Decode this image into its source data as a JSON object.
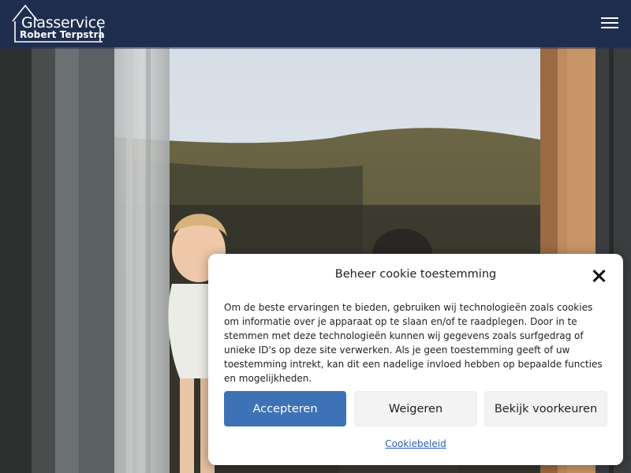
{
  "header": {
    "logo_line1": "Glasservice",
    "logo_line2": "Robert Terpstra",
    "background": "#1f2e4e",
    "menu_icon": "hamburger-menu-icon"
  },
  "hero": {
    "scene": "family-behind-window-photo"
  },
  "cookie_dialog": {
    "title": "Beheer cookie toestemming",
    "close_icon": "close-icon",
    "body": "Om de beste ervaringen te bieden, gebruiken wij technologieën zoals cookies om informatie over je apparaat op te slaan en/of te raadplegen. Door in te stemmen met deze technologieën kunnen wij gegevens zoals surfgedrag of unieke ID's op deze site verwerken. Als je geen toestemming geeft of uw toestemming intrekt, kan dit een nadelige invloed hebben op bepaalde functies en mogelijkheden.",
    "accept_label": "Accepteren",
    "deny_label": "Weigeren",
    "preferences_label": "Bekijk voorkeuren",
    "policy_link": "Cookiebeleid",
    "accent": "#3d72b6"
  }
}
